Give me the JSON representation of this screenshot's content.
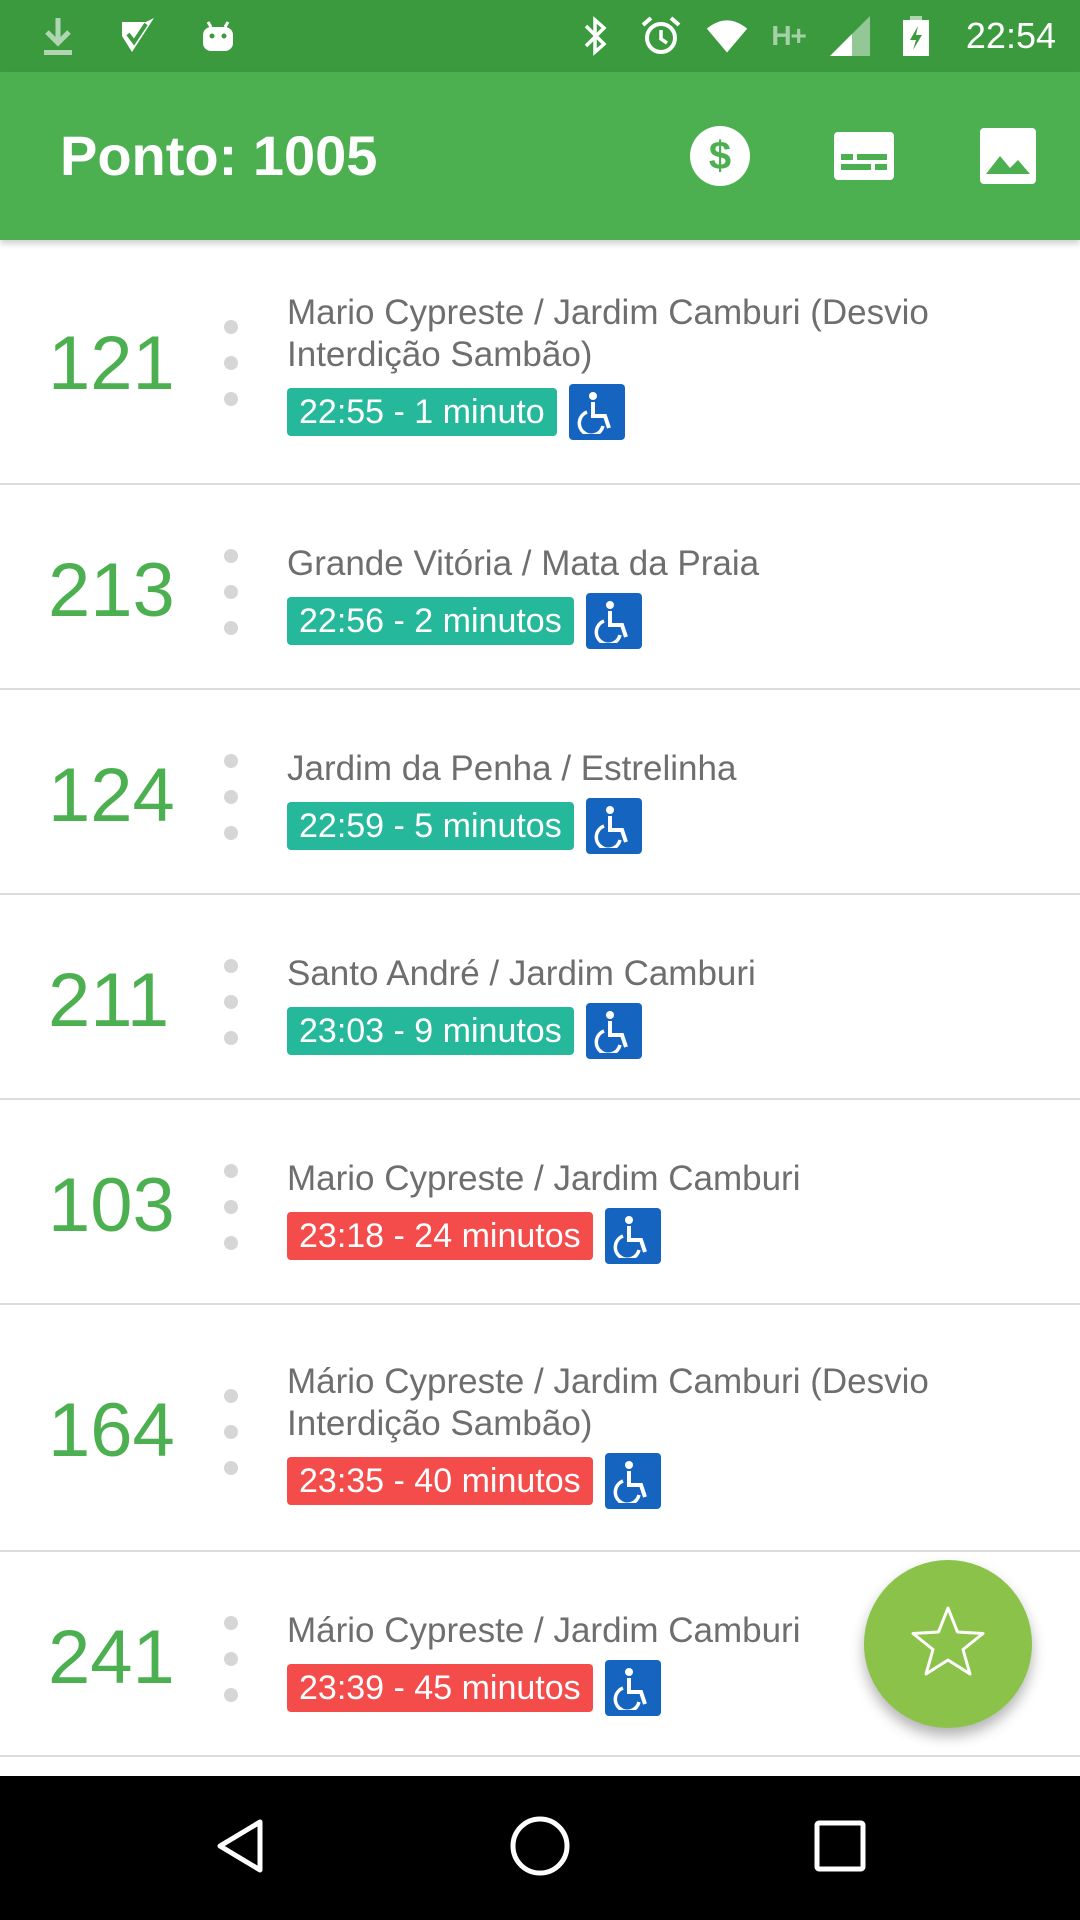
{
  "status_bar": {
    "time": "22:54",
    "network": "H+",
    "icons_left": [
      "download-icon",
      "checkbox-notification-icon",
      "android-icon"
    ],
    "icons_right": [
      "bluetooth-icon",
      "alarm-icon",
      "wifi-icon",
      "signal-icon",
      "battery-charging-icon"
    ]
  },
  "app_bar": {
    "title": "Ponto: 1005",
    "actions": [
      "fare-dollar-icon",
      "subtitles-card-icon",
      "image-icon"
    ]
  },
  "arrivals": [
    {
      "line": "121",
      "route": "Mario Cypreste / Jardim Camburi (Desvio Interdição Sambão)",
      "time": "22:55 - 1 minuto",
      "status": "soon"
    },
    {
      "line": "213",
      "route": "Grande Vitória / Mata da Praia",
      "time": "22:56 - 2 minutos",
      "status": "soon"
    },
    {
      "line": "124",
      "route": "Jardim da Penha / Estrelinha",
      "time": "22:59 - 5 minutos",
      "status": "soon"
    },
    {
      "line": "211",
      "route": "Santo André / Jardim Camburi",
      "time": "23:03 - 9 minutos",
      "status": "soon"
    },
    {
      "line": "103",
      "route": "Mario Cypreste / Jardim Camburi",
      "time": "23:18 - 24 minutos",
      "status": "late"
    },
    {
      "line": "164",
      "route": "Mário Cypreste / Jardim Camburi (Desvio Interdição Sambão)",
      "time": "23:35 - 40 minutos",
      "status": "late"
    },
    {
      "line": "241",
      "route": "Mário Cypreste / Jardim Camburi",
      "time": "23:39 - 45 minutos",
      "status": "late"
    }
  ],
  "colors": {
    "status_bar": "#3b9a3e",
    "app_bar": "#4caf50",
    "line_number": "#4caf50",
    "soon": "#26b89a",
    "late": "#f44b4b",
    "accessible": "#1565c0",
    "fab": "#8bc34a"
  },
  "fab": {
    "icon": "star-outline-icon"
  },
  "nav_bar": {
    "buttons": [
      "back-icon",
      "home-icon",
      "recents-icon"
    ]
  }
}
